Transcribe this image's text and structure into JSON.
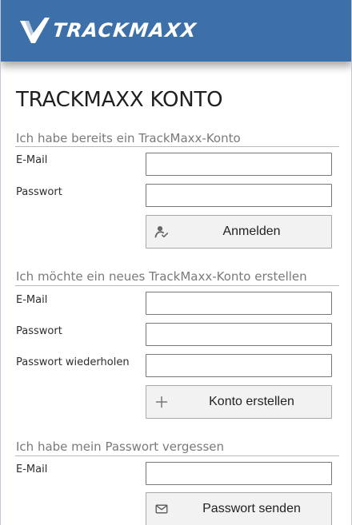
{
  "header": {
    "brand_name": "TRACKMAXX",
    "brand_color": "#3d70a8"
  },
  "page": {
    "title": "TRACKMAXX KONTO"
  },
  "login_section": {
    "title": "Ich habe bereits ein TrackMaxx-Konto",
    "email_label": "E-Mail",
    "email_value": "",
    "password_label": "Passwort",
    "password_value": "",
    "button_label": "Anmelden",
    "button_icon": "user-check-icon"
  },
  "register_section": {
    "title": "Ich möchte ein neues TrackMaxx-Konto erstellen",
    "email_label": "E-Mail",
    "email_value": "",
    "password_label": "Passwort",
    "password_value": "",
    "repeat_password_label": "Passwort wiederholen",
    "repeat_password_value": "",
    "button_label": "Konto erstellen",
    "button_icon": "plus-icon"
  },
  "forgot_section": {
    "title": "Ich habe mein Passwort vergessen",
    "email_label": "E-Mail",
    "email_value": "",
    "button_label": "Passwort senden",
    "button_icon": "mail-icon"
  }
}
